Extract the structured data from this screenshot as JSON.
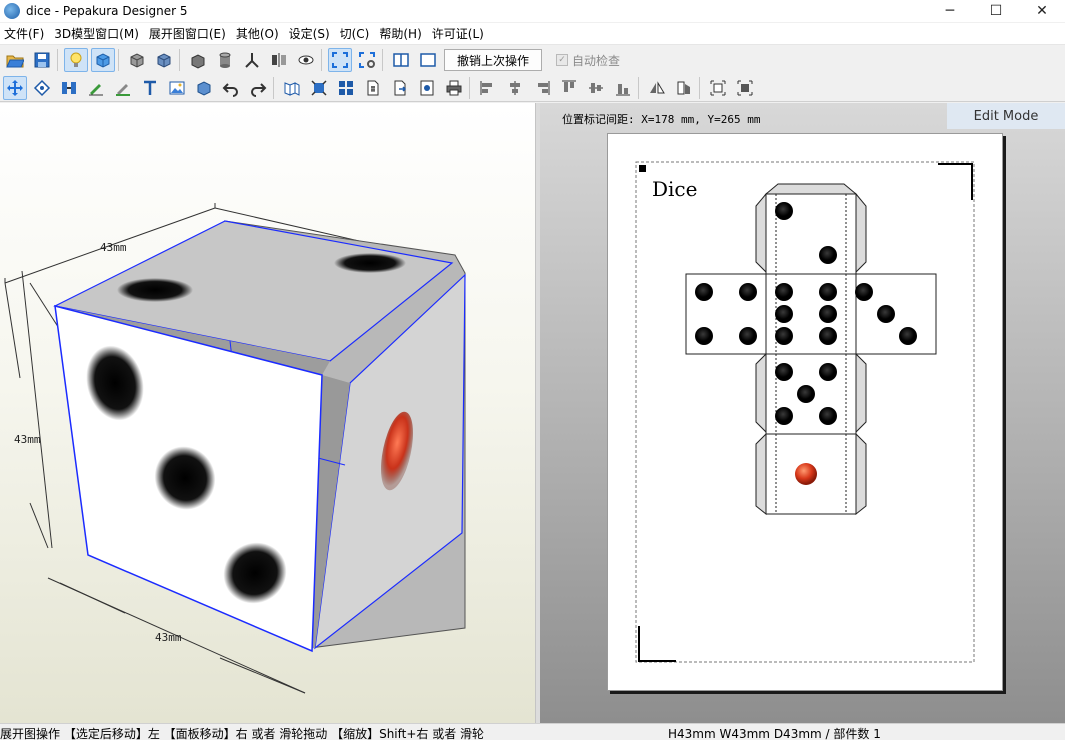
{
  "window": {
    "title": "dice - Pepakura Designer 5",
    "minimize": "─",
    "maximize": "☐",
    "close": "✕"
  },
  "menu": {
    "items": [
      "文件(F)",
      "3D模型窗口(M)",
      "展开图窗口(E)",
      "其他(O)",
      "设定(S)",
      "切(C)",
      "帮助(H)",
      "许可证(L)"
    ]
  },
  "toolbar": {
    "undo_label": "撤销上次操作",
    "autocheck_label": "自动检查",
    "autocheck_checked": true,
    "row1_icons": [
      "open-icon",
      "save-icon",
      "bulb-icon",
      "view3d-icon",
      "cube-move-icon",
      "cube-rotate-icon",
      "box-icon",
      "cylinder-icon",
      "axis-icon",
      "mirror-icon",
      "eye-icon",
      "select-all-icon",
      "select-settings-icon",
      "split-view-icon",
      "single-view-icon"
    ],
    "row2_icons": [
      "move-icon",
      "rotate-icon",
      "join-icon",
      "pencil-icon",
      "fold-icon",
      "text-icon",
      "image-icon",
      "box-3d-icon",
      "undo-icon",
      "redo-icon",
      "unfold-icon",
      "fit-icon",
      "grid-icon",
      "numbers-icon",
      "export-icon",
      "settings-print-icon",
      "print-icon",
      "align-left-icon",
      "align-center-icon",
      "align-right-icon",
      "align-top-icon",
      "align-middle-icon",
      "align-bottom-icon",
      "flip-h-icon",
      "flip-v-icon",
      "arrange-icon",
      "arrange-all-icon"
    ],
    "accent": "#1e6fd9"
  },
  "view3d": {
    "dim_top": "43mm",
    "dim_left": "43mm",
    "dim_bottom": "43mm",
    "outline_color": "#1b2bff",
    "face_color": "#ffffff",
    "red_pip": "#c9321a"
  },
  "view2d": {
    "coord_label": "位置标记间距: X=178 mm, Y=265 mm",
    "edit_mode_label": "Edit Mode",
    "sheet_title": "Dice"
  },
  "status": {
    "left": "展开图操作 【选定后移动】左 【面板移动】右 或者 滑轮拖动 【缩放】Shift+右 或者 滑轮",
    "right": "H43mm W43mm D43mm / 部件数 1"
  }
}
